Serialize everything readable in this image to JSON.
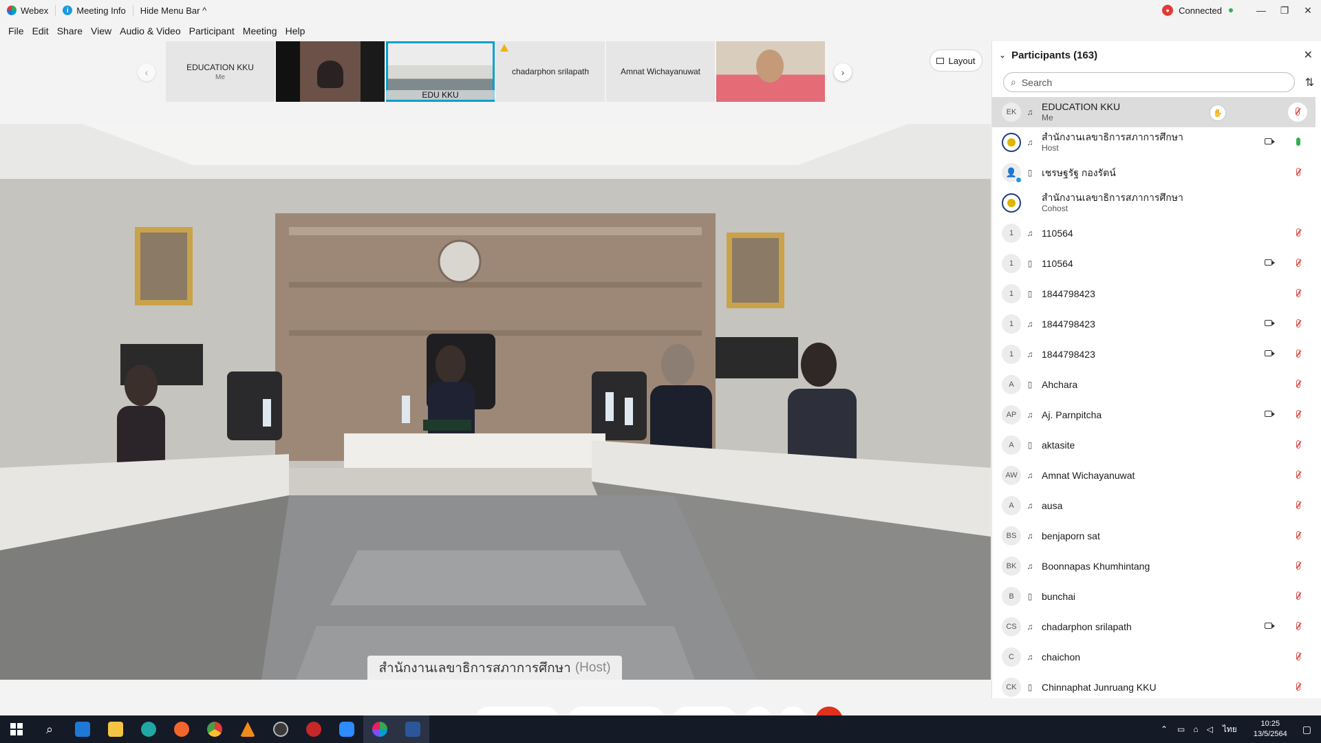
{
  "titlebar": {
    "app_name": "Webex",
    "meeting_info": "Meeting Info",
    "hide_menu_bar": "Hide Menu Bar ^",
    "status": "Connected",
    "status_color": "#2db34a"
  },
  "menu": [
    "File",
    "Edit",
    "Share",
    "View",
    "Audio & Video",
    "Participant",
    "Meeting",
    "Help"
  ],
  "thumbnails": [
    {
      "name": "EDUCATION KKU",
      "sub": "Me",
      "type": "name"
    },
    {
      "name": "",
      "sub": "",
      "type": "video-dark"
    },
    {
      "name": "EDU KKU",
      "sub": "",
      "type": "video-active"
    },
    {
      "name": "chadarphon srilapath",
      "sub": "",
      "type": "name-warn"
    },
    {
      "name": "Amnat Wichayanuwat",
      "sub": "",
      "type": "name"
    },
    {
      "name": "",
      "sub": "",
      "type": "video-light"
    }
  ],
  "layout_button": "Layout",
  "main_speaker": {
    "name": "สำนักงานเลขาธิการสภาการศึกษา",
    "role": "(Host)"
  },
  "participants": {
    "title": "Participants (163)",
    "search_placeholder": "Search",
    "list": [
      {
        "initials": "EK",
        "name": "EDUCATION KKU",
        "role": "Me",
        "device": "headset",
        "video": false,
        "mic": "muted",
        "me": true,
        "raise": true
      },
      {
        "initials": "",
        "name": "สำนักงานเลขาธิการสภาการศึกษา",
        "role": "Host",
        "device": "headset",
        "video": true,
        "mic": "on",
        "avatar": "seal"
      },
      {
        "initials": "",
        "name": "เชรษฐรัฐ กองรัตน์",
        "role": "",
        "device": "phone",
        "video": false,
        "mic": "muted",
        "avatar": "person"
      },
      {
        "initials": "",
        "name": "สำนักงานเลขาธิการสภาการศึกษา",
        "role": "Cohost",
        "device": "",
        "video": false,
        "mic": "none",
        "avatar": "seal"
      },
      {
        "initials": "1",
        "name": "110564",
        "role": "",
        "device": "headset",
        "video": false,
        "mic": "muted"
      },
      {
        "initials": "1",
        "name": "110564",
        "role": "",
        "device": "phone",
        "video": true,
        "mic": "muted"
      },
      {
        "initials": "1",
        "name": "1844798423",
        "role": "",
        "device": "phone",
        "video": false,
        "mic": "muted"
      },
      {
        "initials": "1",
        "name": "1844798423",
        "role": "",
        "device": "headset",
        "video": true,
        "mic": "muted"
      },
      {
        "initials": "1",
        "name": "1844798423",
        "role": "",
        "device": "headset",
        "video": true,
        "mic": "muted"
      },
      {
        "initials": "A",
        "name": "Ahchara",
        "role": "",
        "device": "phone",
        "video": false,
        "mic": "muted"
      },
      {
        "initials": "AP",
        "name": "Aj. Parnpitcha",
        "role": "",
        "device": "headset",
        "video": true,
        "mic": "muted"
      },
      {
        "initials": "A",
        "name": "aktasite",
        "role": "",
        "device": "phone",
        "video": false,
        "mic": "muted"
      },
      {
        "initials": "AW",
        "name": "Amnat Wichayanuwat",
        "role": "",
        "device": "headset",
        "video": false,
        "mic": "muted"
      },
      {
        "initials": "A",
        "name": "ausa",
        "role": "",
        "device": "headset",
        "video": false,
        "mic": "muted"
      },
      {
        "initials": "BS",
        "name": "benjaporn sat",
        "role": "",
        "device": "headset",
        "video": false,
        "mic": "muted"
      },
      {
        "initials": "BK",
        "name": "Boonnapas Khumhintang",
        "role": "",
        "device": "headset",
        "video": false,
        "mic": "muted"
      },
      {
        "initials": "B",
        "name": "bunchai",
        "role": "",
        "device": "phone",
        "video": false,
        "mic": "muted"
      },
      {
        "initials": "CS",
        "name": "chadarphon srilapath",
        "role": "",
        "device": "headset",
        "video": true,
        "mic": "muted"
      },
      {
        "initials": "C",
        "name": "chaichon",
        "role": "",
        "device": "headset",
        "video": false,
        "mic": "muted"
      },
      {
        "initials": "CK",
        "name": "Chinnaphat Junruang KKU",
        "role": "",
        "device": "phone",
        "video": false,
        "mic": "muted"
      }
    ]
  },
  "taskbar": {
    "language": "ไทย",
    "time": "10:25",
    "date": "13/5/2564"
  }
}
